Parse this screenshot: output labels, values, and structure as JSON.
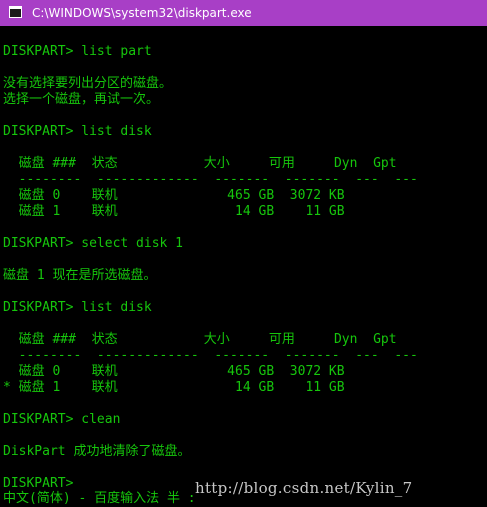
{
  "window": {
    "title": "C:\\WINDOWS\\system32\\diskpart.exe",
    "title_bar_color": "#a83fc6",
    "icon": "console-window-icon"
  },
  "console": {
    "text_color": "#16c60c",
    "background_color": "#000000",
    "lines": [
      "",
      "DISKPART> list part",
      "",
      "没有选择要列出分区的磁盘。",
      "选择一个磁盘，再试一次。",
      "",
      "DISKPART> list disk",
      "",
      "  磁盘 ###  状态           大小     可用     Dyn  Gpt",
      "  --------  -------------  -------  -------  ---  ---",
      "  磁盘 0    联机              465 GB  3072 KB",
      "  磁盘 1    联机               14 GB    11 GB",
      "",
      "DISKPART> select disk 1",
      "",
      "磁盘 1 现在是所选磁盘。",
      "",
      "DISKPART> list disk",
      "",
      "  磁盘 ###  状态           大小     可用     Dyn  Gpt",
      "  --------  -------------  -------  -------  ---  ---",
      "  磁盘 0    联机              465 GB  3072 KB",
      "* 磁盘 1    联机               14 GB    11 GB",
      "",
      "DISKPART> clean",
      "",
      "DiskPart 成功地清除了磁盘。",
      "",
      "DISKPART>",
      "中文(简体) - 百度输入法 半 :"
    ]
  },
  "watermark": {
    "text": "http://blog.csdn.net/Kylin_7",
    "color": "#c7c7c7"
  }
}
